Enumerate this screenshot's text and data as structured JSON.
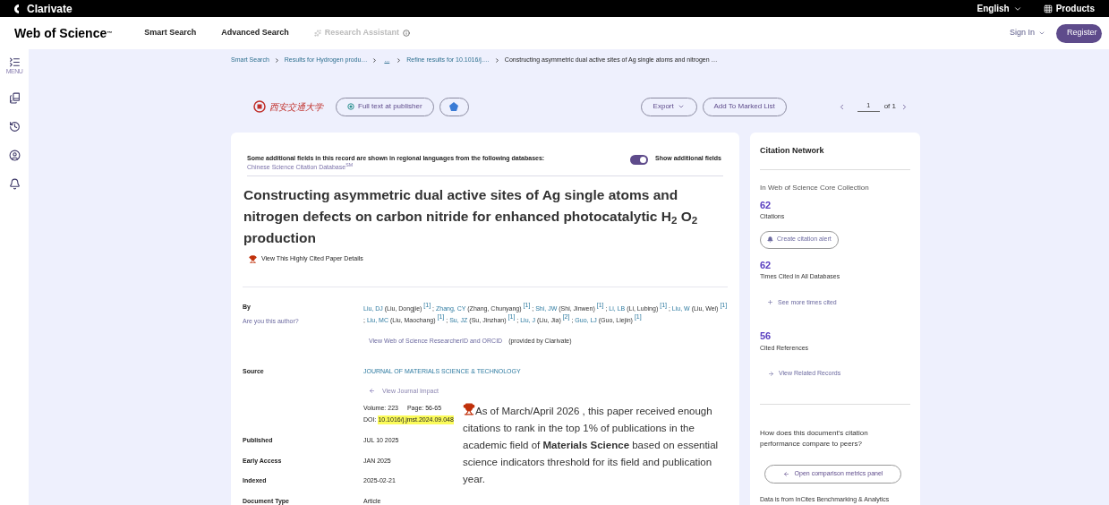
{
  "top_bar": {
    "brand": "Clarivate",
    "language": "English",
    "products": "Products"
  },
  "header": {
    "logo": "Web of Science",
    "logo_mark": "™",
    "nav": [
      {
        "label": "Smart Search",
        "disabled": false
      },
      {
        "label": "Advanced Search",
        "disabled": false
      },
      {
        "label": "Research Assistant",
        "disabled": true
      }
    ],
    "sign_in": "Sign In",
    "register": "Register"
  },
  "sidebar": {
    "menu_label": "MENU"
  },
  "breadcrumb": [
    {
      "label": "Smart Search",
      "current": false
    },
    {
      "label": "Results for Hydrogen produ…",
      "current": false
    },
    {
      "label": "...",
      "current": false
    },
    {
      "label": "Refine results for 10.1016/j.…",
      "current": false
    },
    {
      "label": "Constructing asymmetric dual active sites of Ag single atoms and nitrogen …",
      "current": true
    }
  ],
  "actions": {
    "institution": "西安交通大学",
    "full_text": "Full text at publisher",
    "export": "Export",
    "add_to_list": "Add To Marked List",
    "page": "1",
    "page_total": "of 1"
  },
  "record": {
    "notice": "Some additional fields in this record are shown in regional languages from the following databases:",
    "notice_link": "Chinese Science Citation Database$^{SM}$",
    "toggle": {
      "label": "Show additional fields",
      "on": true
    },
    "title": "Constructing asymmetric dual active sites of Ag single atoms and nitrogen defects on carbon nitride for enhanced photocatalytic H$_{2}$ O$_{2}$ production",
    "highly_cited": "View This Highly Cited Paper Details",
    "fields": [
      {
        "kind": "authors",
        "label": "By",
        "sublabel": "Are you this author?",
        "authors": [
          {
            "abbr": "Liu, DJ",
            "full": "(Liu, Dongjie)",
            "ref": "[1]"
          },
          {
            "abbr": "Zhang, CY",
            "full": "(Zhang, Chunyang)",
            "ref": "[1]"
          },
          {
            "abbr": "Shi, JW",
            "full": "(Shi, Jinwen)",
            "ref": "[1]"
          },
          {
            "abbr": "Li, LB",
            "full": "(Li, Lubing)",
            "ref": "[1]"
          },
          {
            "abbr": "Liu, W",
            "full": "(Liu, Wei)",
            "ref": "[1]"
          },
          {
            "abbr": "Liu, MC",
            "full": "(Liu, Maochang)",
            "ref": "[1]"
          },
          {
            "abbr": "Su, JZ",
            "full": "(Su, Jinzhan)",
            "ref": "[1]"
          },
          {
            "abbr": "Liu, J",
            "full": "(Liu, Jia)",
            "ref": "[2]"
          },
          {
            "abbr": "Guo, LJ",
            "full": "(Guo, Liejin)",
            "ref": "[1]"
          }
        ],
        "separator": ";",
        "researcher_link": "View Web of Science ResearcherID and ORCID",
        "provided": "(provided by Clarivate)"
      },
      {
        "kind": "source",
        "label": "Source",
        "journal": "JOURNAL OF MATERIALS SCIENCE & TECHNOLOGY",
        "impact": "View Journal Impact",
        "volume": "Volume: 223",
        "page": "Page: 56-65",
        "doi_label": "DOI:",
        "doi": "10.1016/j.jmst.2024.09.048"
      },
      {
        "kind": "text",
        "label": "Published",
        "value": "JUL 10 2025"
      },
      {
        "kind": "text",
        "label": "Early Access",
        "value": "JAN 2025"
      },
      {
        "kind": "text",
        "label": "Indexed",
        "value": "2025-02-21"
      },
      {
        "kind": "text",
        "label": "Document Type",
        "value": "Article"
      }
    ]
  },
  "popover": {
    "text": "As of March/April 2026 , this paper received enough citations to rank in the top 1% of publications in the academic field of **Materials Science** based on essential science indicators threshold for its field and publication year."
  },
  "citation_network": {
    "title": "Citation Network",
    "collection": "In Web of Science Core Collection",
    "citations": "62",
    "citations_label": "Citations",
    "alert": "Create citation alert",
    "all_db": "62",
    "all_db_label": "Times Cited in All Databases",
    "see_more": "See more times cited",
    "refs": "56",
    "refs_label": "Cited References",
    "related": "View Related Records",
    "question": "How does this document's citation performance compare to peers?",
    "compare": "Open comparison metrics panel",
    "source": "Data is from InCites Benchmarking & Analytics"
  }
}
